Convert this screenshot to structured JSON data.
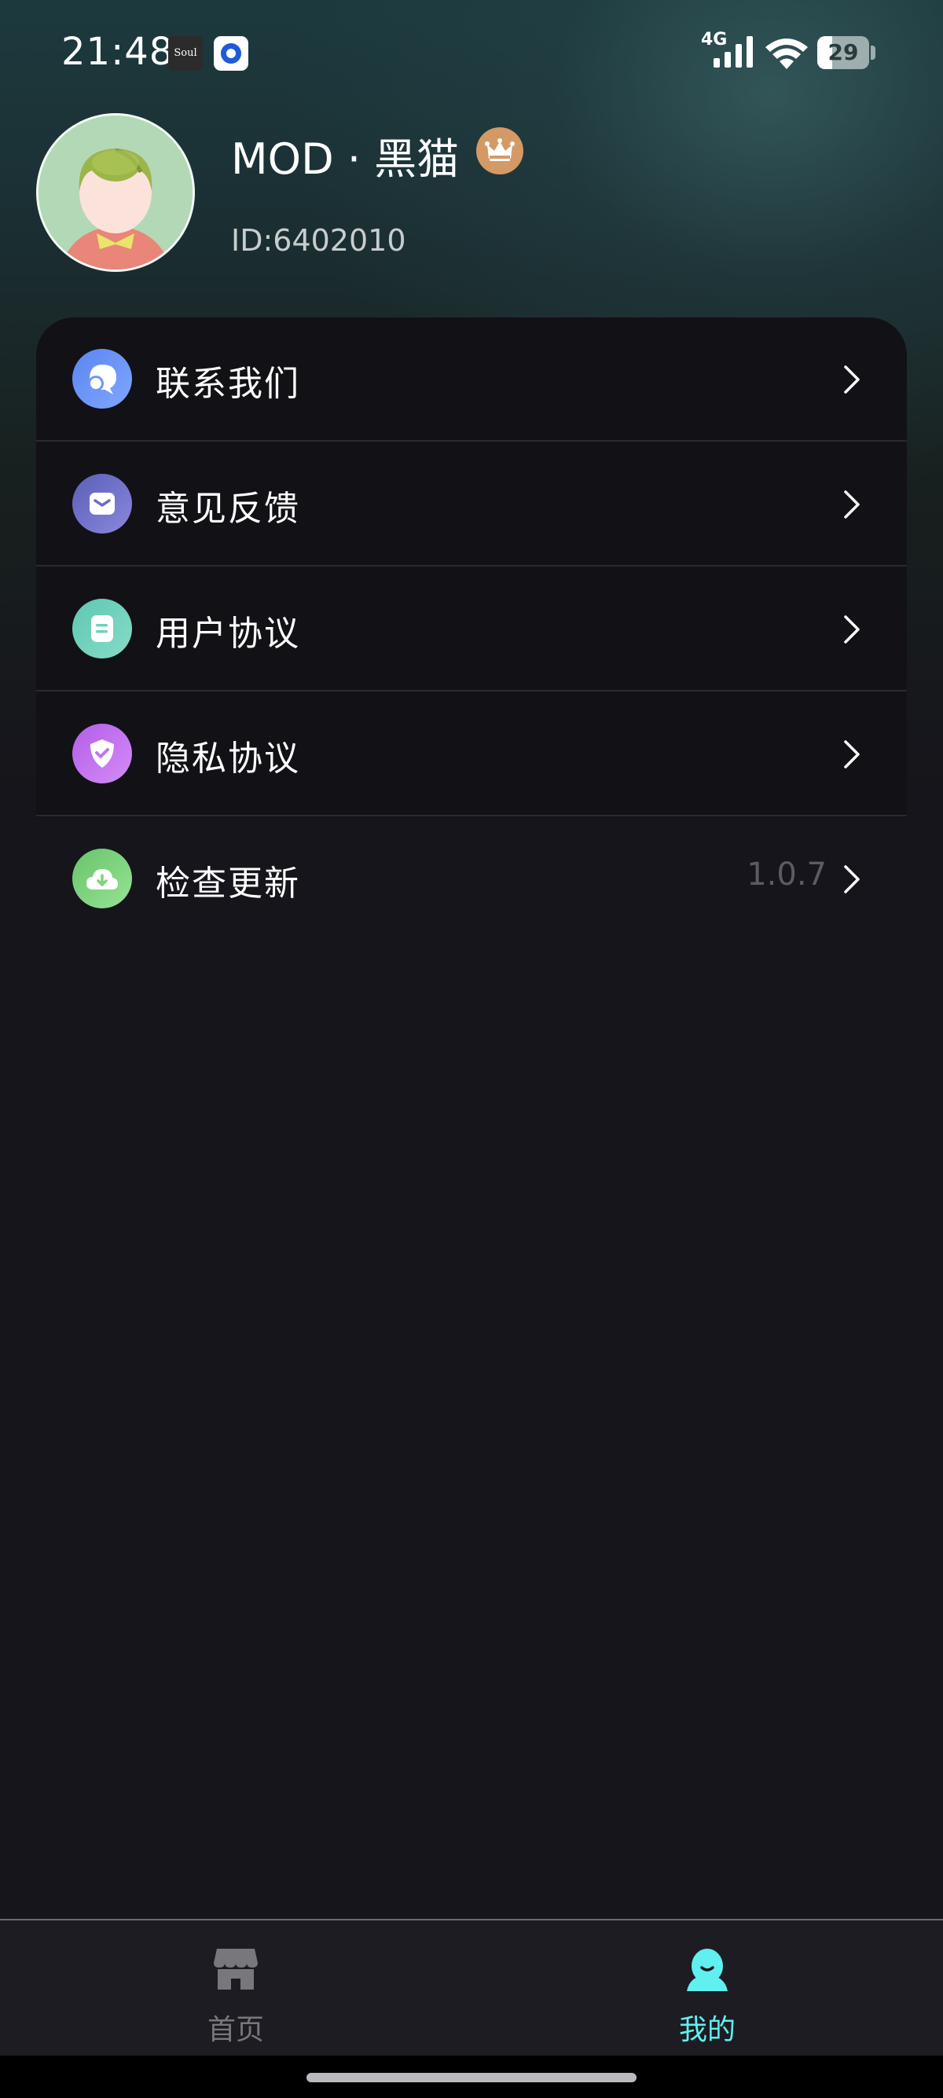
{
  "status_bar": {
    "time": "21:48",
    "notification_text": "Soul",
    "network": "4G",
    "battery_level": "29"
  },
  "profile": {
    "name": "MOD · 黑猫",
    "id_text": "ID:6402010"
  },
  "menu": [
    {
      "label": "联系我们",
      "value": "",
      "icon": "chat-bubble-icon",
      "color_from": "#5b86f0",
      "color_to": "#7fa6ff"
    },
    {
      "label": "意见反馈",
      "value": "",
      "icon": "mail-icon",
      "color_from": "#5b5fb8",
      "color_to": "#8b87dd"
    },
    {
      "label": "用户协议",
      "value": "",
      "icon": "document-icon",
      "color_from": "#5fc7b1",
      "color_to": "#86dcc8"
    },
    {
      "label": "隐私协议",
      "value": "",
      "icon": "shield-check-icon",
      "color_from": "#b35ee8",
      "color_to": "#d58cf6"
    },
    {
      "label": "检查更新",
      "value": "1.0.7",
      "icon": "cloud-download-icon",
      "color_from": "#67c56a",
      "color_to": "#98e295"
    }
  ],
  "bottom_nav": {
    "tabs": [
      {
        "label": "首页",
        "icon": "store-icon",
        "active": false
      },
      {
        "label": "我的",
        "icon": "person-icon",
        "active": true
      }
    ],
    "active_color": "#5ff0ef",
    "inactive_color": "#77777c"
  }
}
